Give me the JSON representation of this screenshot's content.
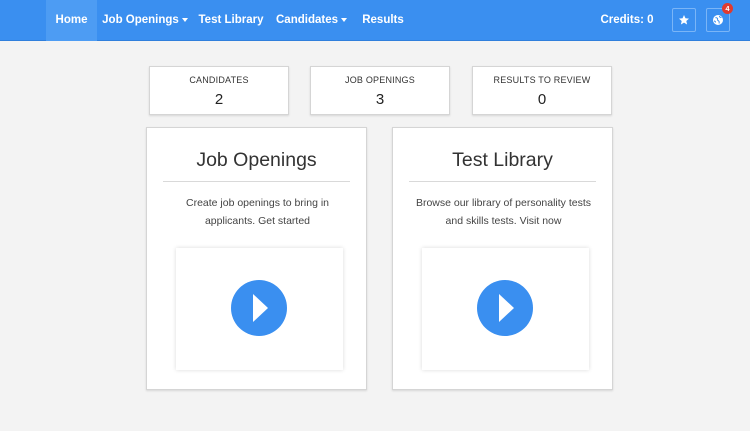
{
  "nav": {
    "items": [
      {
        "label": "Home",
        "active": true,
        "dropdown": false
      },
      {
        "label": "Job Openings",
        "active": false,
        "dropdown": true
      },
      {
        "label": "Test Library",
        "active": false,
        "dropdown": false
      },
      {
        "label": "Candidates",
        "active": false,
        "dropdown": true
      },
      {
        "label": "Results",
        "active": false,
        "dropdown": false
      }
    ],
    "credits": "Credits: 0",
    "star_icon": "star-icon",
    "globe_icon": "globe-icon",
    "notification_count": "4"
  },
  "stats": [
    {
      "label": "CANDIDATES",
      "value": "2"
    },
    {
      "label": "JOB OPENINGS",
      "value": "3"
    },
    {
      "label": "RESULTS TO REVIEW",
      "value": "0"
    }
  ],
  "cards": [
    {
      "title": "Job Openings",
      "description": "Create job openings to bring in applicants. Get started",
      "icon": "play-icon"
    },
    {
      "title": "Test Library",
      "description": "Browse our library of personality tests and skills tests. Visit now",
      "icon": "play-icon"
    }
  ],
  "colors": {
    "accent": "#3a8ff0",
    "badge": "#e03a2f",
    "background": "#f3f3f3"
  }
}
